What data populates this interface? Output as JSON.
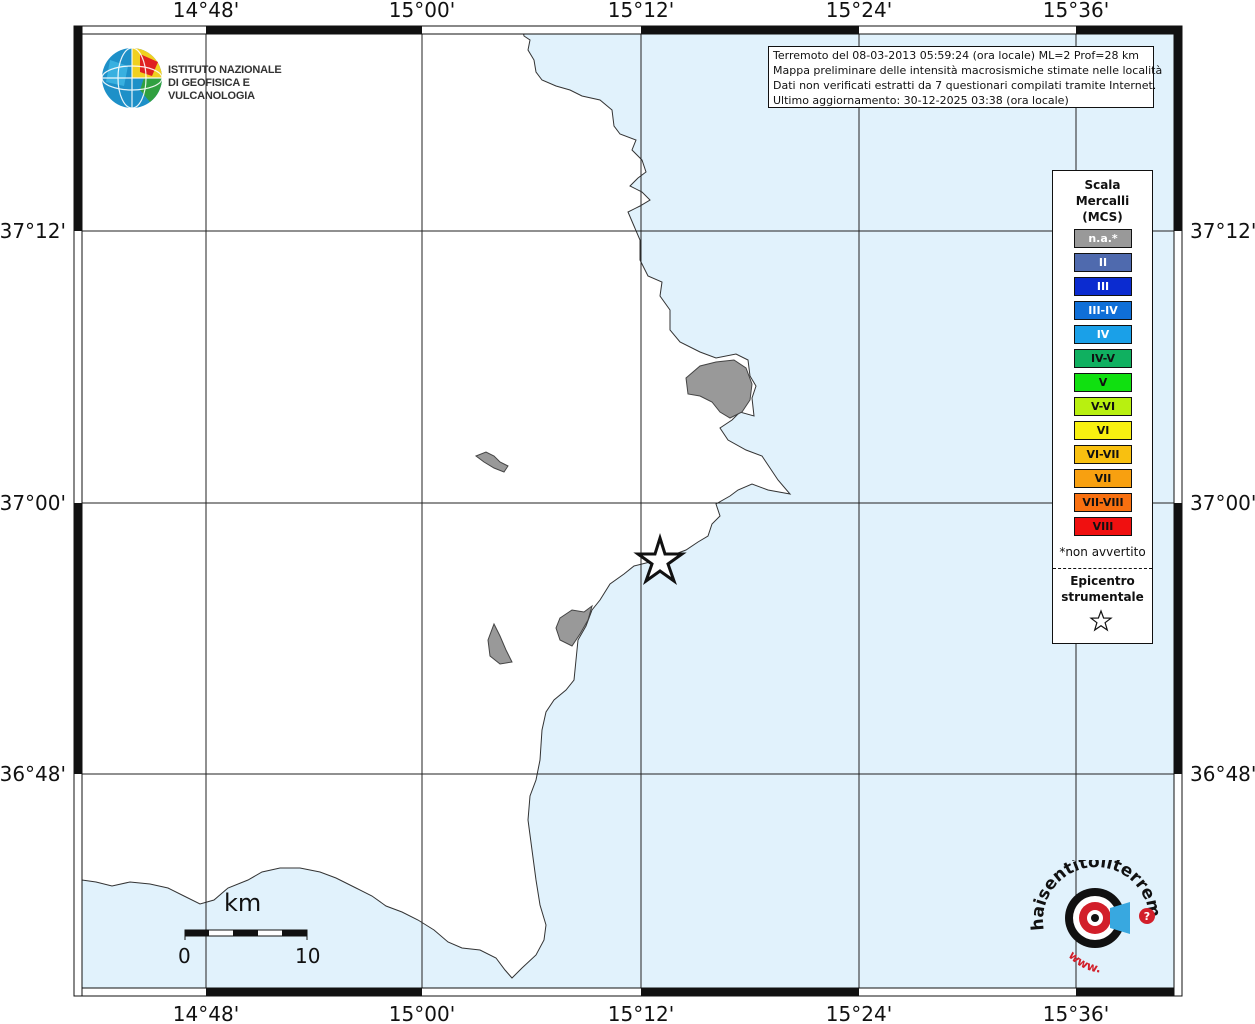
{
  "map": {
    "ticks_top": [
      "14°48'",
      "15°00'",
      "15°12'",
      "15°24'",
      "15°36'"
    ],
    "ticks_bottom": [
      "14°48'",
      "15°00'",
      "15°12'",
      "15°24'",
      "15°36'"
    ],
    "ticks_left": [
      "37°12'",
      "37°00'",
      "36°48'"
    ],
    "ticks_right": [
      "37°12'",
      "37°00'",
      "36°48'"
    ],
    "sea_color": "#e1f2fc",
    "land_color": "#ffffff",
    "urban_color": "#999999",
    "epicenter_symbol": "star-icon"
  },
  "logo": {
    "line1": "ISTITUTO NAZIONALE",
    "line2": "DI GEOFISICA E VULCANOLOGIA"
  },
  "info": {
    "line1": "Terremoto del 08-03-2013 05:59:24 (ora locale) ML=2 Prof=28 km",
    "line2": "Mappa preliminare delle intensità macrosismiche stimate nelle località",
    "line3": "Dati non verificati estratti da 7 questionari compilati tramite Internet.",
    "line4": "Ultimo aggiornamento: 30-12-2025 03:38 (ora locale)"
  },
  "legend": {
    "title1": "Scala",
    "title2": "Mercalli",
    "title3": "(MCS)",
    "items": [
      {
        "label": "n.a.*",
        "color": "#999999"
      },
      {
        "label": "II",
        "color": "#4f6aae"
      },
      {
        "label": "III",
        "color": "#0b2bd0"
      },
      {
        "label": "III-IV",
        "color": "#0f6fd8"
      },
      {
        "label": "IV",
        "color": "#1aa0e8"
      },
      {
        "label": "IV-V",
        "color": "#10b060"
      },
      {
        "label": "V",
        "color": "#10e010"
      },
      {
        "label": "V-VI",
        "color": "#b8f010"
      },
      {
        "label": "VI",
        "color": "#f8f010"
      },
      {
        "label": "VI-VII",
        "color": "#f8c010"
      },
      {
        "label": "VII",
        "color": "#f8a010"
      },
      {
        "label": "VII-VIII",
        "color": "#f87010"
      },
      {
        "label": "VIII",
        "color": "#f01010"
      }
    ],
    "note": "*non avvertito",
    "epicenter1": "Epicentro",
    "epicenter2": "strumentale"
  },
  "scale": {
    "unit": "km",
    "start": "0",
    "end": "10"
  },
  "hsit_logo": {
    "text": "haisentitoilterremoto.it",
    "www": "www."
  }
}
